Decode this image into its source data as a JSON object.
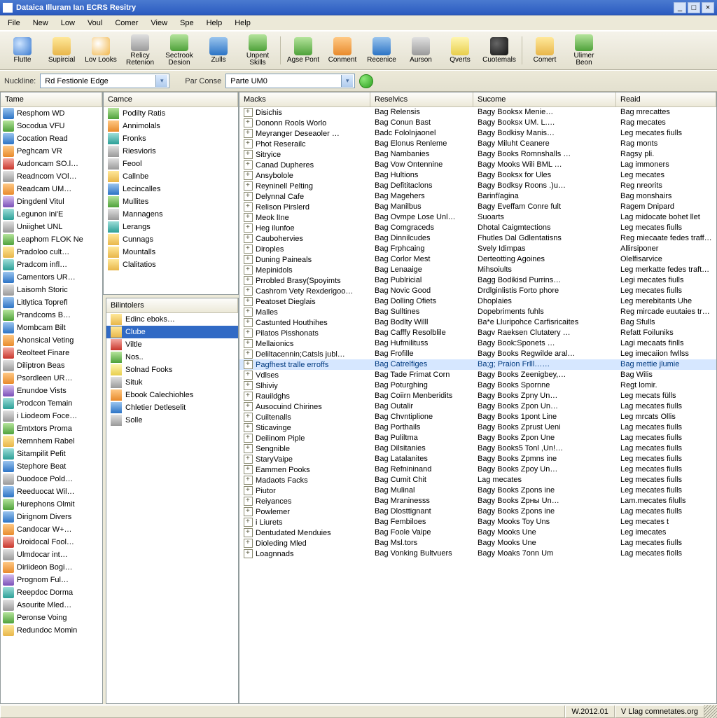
{
  "window": {
    "title": "Dataica Illuram Ian ECRS Resitry"
  },
  "menu": [
    "File",
    "New",
    "Low",
    "Voul",
    "Comer",
    "View",
    "Spe",
    "Help",
    "Help"
  ],
  "toolbar": [
    {
      "label": "Flutte",
      "icon": "ic-globe"
    },
    {
      "label": "Supircial",
      "icon": "ic-folder"
    },
    {
      "label": "Lov Looks",
      "icon": "ic-clock"
    },
    {
      "label": "Relicy Retenion",
      "icon": "ic-gray"
    },
    {
      "label": "Sectrook Desion",
      "icon": "ic-green"
    },
    {
      "label": "Zulls",
      "icon": "ic-blue"
    },
    {
      "label": "Unpent Skills",
      "icon": "ic-green"
    },
    {
      "label": "Agse Pont",
      "icon": "ic-green"
    },
    {
      "label": "Conment",
      "icon": "ic-orange"
    },
    {
      "label": "Recenice",
      "icon": "ic-blue"
    },
    {
      "label": "Aurson",
      "icon": "ic-gray"
    },
    {
      "label": "Qverts",
      "icon": "ic-yellow"
    },
    {
      "label": "Cuotemals",
      "icon": "ic-black"
    },
    {
      "label": "Comert",
      "icon": "ic-folder"
    },
    {
      "label": "Ulimer Beon",
      "icon": "ic-green"
    }
  ],
  "addr": {
    "nuckline_label": "Nuckline:",
    "nuckline_value": "Rd Festionle Edge",
    "parcourse_label": "Par Conse",
    "parcourse_value": "Parte UM0"
  },
  "left": {
    "header": "Tame",
    "items": [
      "Resphom WD",
      "Socodua VFU",
      "Cocation Read",
      "Рeghcam VR",
      "Audoncam SO.l…",
      "Readncom VOl…",
      "Readcam UM…",
      "Dingdenl Vitul",
      "Legunon ini'E",
      "Uniighet UNL",
      "Leaphom FLOK Ne",
      "Pradoloo cult…",
      "Pradcom infl…",
      "Camentors UR…",
      "Laisomh Storic",
      "Litlytica Toprefl",
      "Prandcoms B…",
      "Mombcam Bilt",
      "Ahonsical Veting",
      "Reolteet Finare",
      "Diliptron Beas",
      "Psordleen UR…",
      "Enundoe Vists",
      "Prodcon Temain",
      "i Liodeom Foce…",
      "Emtxtors Proma",
      "Remnhem Rabel",
      "Sitampilit Pefit",
      "Stephore Beat",
      "Duodoce Pold…",
      "Reeduocat Wil…",
      "Hurephons Olmit",
      "Dirignom Divers",
      "Candocar W+…",
      "Uroidocal Fool…",
      "Ulmdocar int…",
      "Diriideon Вogi…",
      "Prognom Ful…",
      "Reepdoc Dorma",
      "Asourite Mled…",
      "Peronse Voing",
      "Redundoc Momin"
    ]
  },
  "mid_top": {
    "header": "Camce",
    "items": [
      {
        "label": "Podilty Ratis",
        "icon": "ic-green"
      },
      {
        "label": "Annimolals",
        "icon": "ic-orange"
      },
      {
        "label": "Fronks",
        "icon": "ic-teal"
      },
      {
        "label": "Riesvioris",
        "icon": "ic-gray"
      },
      {
        "label": "Feool",
        "icon": "ic-gray"
      },
      {
        "label": "Callnbe",
        "icon": "ic-folder"
      },
      {
        "label": "Lecincalles",
        "icon": "ic-blue"
      },
      {
        "label": "Mullites",
        "icon": "ic-green"
      },
      {
        "label": "Mannagens",
        "icon": "ic-gray"
      },
      {
        "label": "Lerangs",
        "icon": "ic-teal"
      },
      {
        "label": "Cunnags",
        "icon": "ic-folder"
      },
      {
        "label": "Mountalls",
        "icon": "ic-folder"
      },
      {
        "label": "Clalitatios",
        "icon": "ic-folder"
      }
    ]
  },
  "mid_bot": {
    "header": "Bilintolers",
    "selected": 1,
    "items": [
      {
        "label": "Edinc eboks…",
        "icon": "ic-folder"
      },
      {
        "label": "Clube",
        "icon": "ic-folder"
      },
      {
        "label": "Viltle",
        "icon": "ic-red"
      },
      {
        "label": "Nos..",
        "icon": "ic-green"
      },
      {
        "label": "Solnad Fooks",
        "icon": "ic-yellow"
      },
      {
        "label": "Situk",
        "icon": "ic-gray"
      },
      {
        "label": "Ebook Calechiohles",
        "icon": "ic-orange"
      },
      {
        "label": "Chletier Detleselit",
        "icon": "ic-blue"
      },
      {
        "label": "Solle",
        "icon": "ic-gray"
      }
    ]
  },
  "right": {
    "headers": [
      "Macks",
      "Reselvics",
      "Sucome",
      "Reaid"
    ],
    "selected": 24,
    "rows": [
      [
        "Disichis",
        "Bag Relensis",
        "Bagy Booksx Menie…",
        "Bag mrecattes"
      ],
      [
        "Dononn Rools Worlo",
        "Bag Conun Bast",
        "Bagy Booksx UM. L.…",
        "Rag mecates"
      ],
      [
        "Meyranger Deseaoler …",
        "Badc Fololnjаonel",
        "Bagy Bodkisy Manis…",
        "Leg mecates fiulls"
      ],
      [
        "Phot Reserailc",
        "Bag Elonus Renleme",
        "Bagy Miluht Сeanere",
        "Rag monts"
      ],
      [
        "Sitryice",
        "Bag Nambanies",
        "Bagy Books Romnshalls …",
        "Ragsy pli."
      ],
      [
        "Canad Dupheres",
        "Bag Vow Ontennine",
        "Bagy Mooks Wili BML …",
        "Lag immoners"
      ],
      [
        "Ansybolole",
        "Bag Hultions",
        "Вagy Booksx for Ules",
        "Leg mecates"
      ],
      [
        "Reyninell Pelting",
        "Bag Defititaclons",
        "Bagy Bodksy Roons .)u…",
        "Reg nreorits"
      ],
      [
        "Delynnal Cafe",
        "Bag Маgehers",
        "Barinfïagina",
        "Bag monshairs"
      ],
      [
        "Relison Pirslerd",
        "Bag Manilbus",
        "Bagy Eveffam Conre fult",
        "Ragem Dnipard"
      ],
      [
        "Meok lIne",
        "Bag Ovmpe Lose Unl…",
        "Suoarts",
        "Lag midocate bohet llet"
      ],
      [
        "Heg ilunfoe",
        "Bag Comgraceds",
        "Dhotal Caigmtections",
        "Leg mecates fiulls"
      ],
      [
        "Caubohervies",
        "Bag Dinnilcudes",
        "Fhutles Dal Gdlentatisns",
        "Reg miecaate fedes traff…"
      ],
      [
        "Diroples",
        "Bag Frphcaing",
        "Svely Idimpas",
        "Allirsiponer"
      ],
      [
        "Duning Paineals",
        "Вag Corlor Mest",
        "Derteotting Agoines",
        "Olelfisarvice"
      ],
      [
        "Mepinidols",
        "Bag Lenaaige",
        "Mihsoiults",
        "Leg merkatte fedes traft…"
      ],
      [
        "Prrobled Вrasy(Spoyimts",
        "Bag Publricial",
        "Bagg Bodikisd Purrins…",
        "Legi mecates fiulls"
      ],
      [
        "Cashrom Vety Rexderigoo…",
        "Bag Novic Good",
        "Drdlginlistis Forto phore",
        "Leg mecates fiulls"
      ],
      [
        "Peatoset Dieglais",
        "Bag Dolling Ofiets",
        "Dhoplaies",
        "Leg merebitants Uhe"
      ],
      [
        "Malles",
        "Bag Sulltines",
        "Dopebriments fuhls",
        "Reg mircade euutaies traft…"
      ],
      [
        "Castunted Houthihes",
        "Bag Bodlty Willl",
        "Ba*e Lluripohce Carfisricaites",
        "Bag Sfulls"
      ],
      [
        "Pilatos Pisshonats",
        "Bag Cafffy Resolblile",
        "Bagv Raeksen Clutatery …",
        "Refatt Foiluniks"
      ],
      [
        "Mellaionics",
        "Bag Hufmilituss",
        "Bagy Book:Sponets …",
        "Lagi mecaats finlls"
      ],
      [
        "Deliltacennin;Catsls jubl…",
        "Bag Frofille",
        "Bagy Books Regwilde aral…",
        "Leg imecaiion fwllss"
      ],
      [
        "Pagfhest tralle erroffs",
        "Bag Catrelfiges",
        "Ba;g; Praion Frlll……",
        "Bag mettie jlumie"
      ],
      [
        "Vdlses",
        "Bag Tade Frimat Corn",
        "Bagy Books Zeenigbey,…",
        "Bag Wilis"
      ],
      [
        "Slhiviy",
        "Bag Poturghing",
        "Bagy Books Spornne",
        "Regt lomir."
      ],
      [
        "Rauildghs",
        "Bag Coiirn Menberidits",
        "Bagy Books Zpny Un…",
        "Leg mecats fülls"
      ],
      [
        "Ausocuind Chirines",
        "Bag Outalir",
        "Bagy Books Zpon Un…",
        "Lag mecates fiulls"
      ],
      [
        "Cuiltenalls",
        "Bag Chvntiplione",
        "Вagy Bоoks 1pont Line",
        "Leg mrcats Ollis"
      ],
      [
        "Sticavinge",
        "Bag Porthails",
        "Bagy Books Zprust Ueni",
        "Lag mecates fiulls"
      ],
      [
        "Deilinom Piple",
        "Bag Рuliltma",
        "Bagy Books Zpon Une",
        "Lag mecates fiulls"
      ],
      [
        "Sengnible",
        "Bag Dilsitanies",
        "Bagy Books5 Tonl ,Un!…",
        "Lag mecates fiulls"
      ],
      [
        "StaryVaipe",
        "Bag Latalanites",
        "Bagy Books Zpmns ine",
        "Leg mecates fiulls"
      ],
      [
        "Eammen Pooks",
        "Bag Refnininand",
        "Bagy Books Zpoy Un…",
        "Leg mecates fiulls"
      ],
      [
        "Madaots Facks",
        "Bag Cumit Chit",
        "Lag mecates",
        "Leg mecates fiulls"
      ],
      [
        "Piutor",
        "Bag Mulinal",
        "Bagy Books Zpons ine",
        "Leg mecates fiulls"
      ],
      [
        "Reiyances",
        "Bag Mraninesss",
        "Bagy Books Zpны Un…",
        "Lam.mecates filulls"
      ],
      [
        "Powlemer",
        "Bag Dlosttignant",
        "Bagy Books Zpons ine",
        "Lag mecates fiulls"
      ],
      [
        "i Liurets",
        "Bag Fembiloes",
        "Bagy Mоoks Toy Uns",
        "Leg mecates t"
      ],
      [
        "Dentudated Menduies",
        "Bag Foole Vaipe",
        "Bagy Mooks Une",
        "Leg imecates"
      ],
      [
        "Dioleding Mled",
        "Bag Msl.tors",
        "Bagy Mooks Une",
        "Lag mecates fiulls"
      ],
      [
        "Loagnnads",
        "Вag Vonking Bultvuers",
        "Bagy Moaks 7onn Um",
        "Lag mecates fiolls"
      ]
    ]
  },
  "status": {
    "a": "W.2012.01",
    "b": "V Llag comnetates.org"
  }
}
